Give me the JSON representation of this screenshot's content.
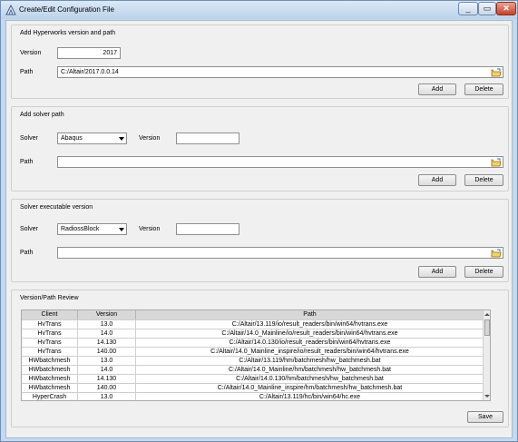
{
  "window": {
    "title": "Create/Edit Configuration File"
  },
  "hyperworks": {
    "group_title": "Add Hyperworks version and path",
    "version_label": "Version",
    "version_value": "2017",
    "path_label": "Path",
    "path_value": "C:/Altair/2017.0.0.14",
    "add_label": "Add",
    "delete_label": "Delete"
  },
  "solver_path": {
    "group_title": "Add solver path",
    "solver_label": "Solver",
    "solver_value": "Abaqus",
    "version_label": "Version",
    "version_value": "",
    "path_label": "Path",
    "path_value": "",
    "add_label": "Add",
    "delete_label": "Delete"
  },
  "solver_exec": {
    "group_title": "Solver executable version",
    "solver_label": "Solver",
    "solver_value": "RadiossBlock",
    "version_label": "Version",
    "version_value": "",
    "path_label": "Path",
    "path_value": "",
    "add_label": "Add",
    "delete_label": "Delete"
  },
  "review": {
    "group_title": "Version/Path Review",
    "columns": [
      "Client",
      "Version",
      "Path"
    ],
    "rows": [
      [
        "HvTrans",
        "13.0",
        "C:/Altair/13.119/io/result_readers/bin/win64/hvtrans.exe"
      ],
      [
        "HvTrans",
        "14.0",
        "C:/Altair/14.0_Mainline/io/result_readers/bin/win64/hvtrans.exe"
      ],
      [
        "HvTrans",
        "14.130",
        "C:/Altair/14.0.130/io/result_readers/bin/win64/hvtrans.exe"
      ],
      [
        "HvTrans",
        "140.00",
        "C:/Altair/14.0_Mainline_inspire/io/result_readers/bin/win64/hvtrans.exe"
      ],
      [
        "HWbatchmesh",
        "13.0",
        "C:/Altair/13.119/hm/batchmesh/hw_batchmesh.bat"
      ],
      [
        "HWbatchmesh",
        "14.0",
        "C:/Altair/14.0_Mainline/hm/batchmesh/hw_batchmesh.bat"
      ],
      [
        "HWbatchmesh",
        "14.130",
        "C:/Altair/14.0.130/hm/batchmesh/hw_batchmesh.bat"
      ],
      [
        "HWbatchmesh",
        "140.00",
        "C:/Altair/14.0_Mainline_inspire/hm/batchmesh/hw_batchmesh.bat"
      ],
      [
        "HyperCrash",
        "13.0",
        "C:/Altair/13.119/hc/bin/win64/hc.exe"
      ]
    ],
    "save_label": "Save"
  },
  "icons": [
    "app-icon",
    "minimize-icon",
    "maximize-icon",
    "close-icon",
    "folder-open-icon"
  ]
}
